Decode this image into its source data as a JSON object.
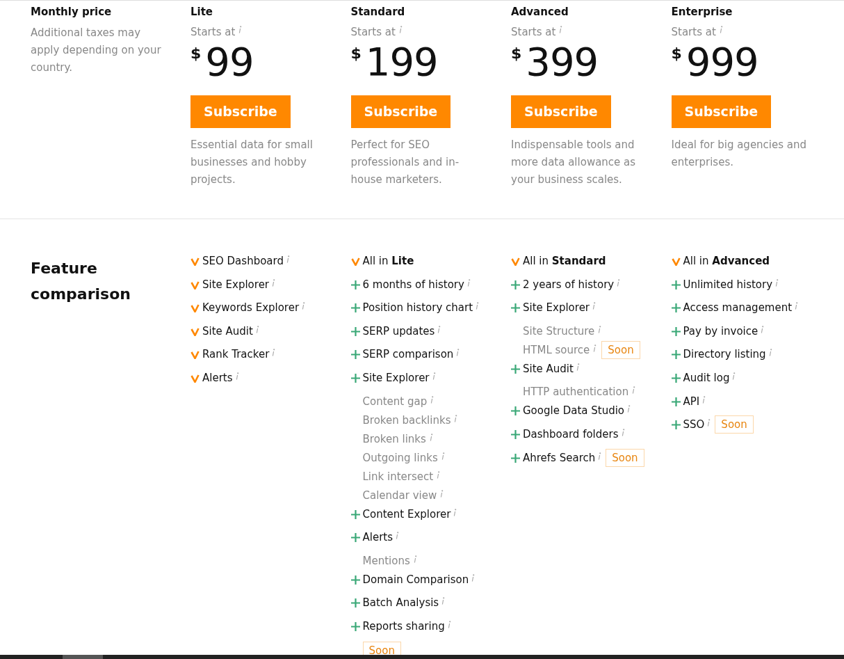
{
  "pricing": {
    "label": "Monthly price",
    "note": "Additional taxes may apply depending on your country."
  },
  "plans": [
    {
      "name": "Lite",
      "starts_at": "Starts at",
      "currency": "$",
      "price": "99",
      "button": "Subscribe",
      "description": "Essential data for small businesses and hobby projects."
    },
    {
      "name": "Standard",
      "starts_at": "Starts at",
      "currency": "$",
      "price": "199",
      "button": "Subscribe",
      "description": "Perfect for SEO professionals and in-house marketers."
    },
    {
      "name": "Advanced",
      "starts_at": "Starts at",
      "currency": "$",
      "price": "399",
      "button": "Subscribe",
      "description": "Indispensable tools and more data allowance as your business scales."
    },
    {
      "name": "Enterprise",
      "starts_at": "Starts at",
      "currency": "$",
      "price": "999",
      "button": "Subscribe",
      "description": "Ideal for big agencies and enterprises."
    }
  ],
  "features": {
    "title": "Feature comparison",
    "columns": [
      [
        {
          "kind": "included",
          "text": "SEO Dashboard",
          "info": true
        },
        {
          "kind": "included",
          "text": "Site Explorer",
          "info": true
        },
        {
          "kind": "included",
          "text": "Keywords Explorer",
          "info": true
        },
        {
          "kind": "included",
          "text": "Site Audit",
          "info": true
        },
        {
          "kind": "included",
          "text": "Rank Tracker",
          "info": true
        },
        {
          "kind": "included",
          "text": "Alerts",
          "info": true
        }
      ],
      [
        {
          "kind": "included",
          "text": "All in **Lite**",
          "info": false
        },
        {
          "kind": "added",
          "text": "6 months of history",
          "info": true
        },
        {
          "kind": "added",
          "text": "Position history chart",
          "info": true
        },
        {
          "kind": "added",
          "text": "SERP updates",
          "info": true
        },
        {
          "kind": "added",
          "text": "SERP comparison",
          "info": true
        },
        {
          "kind": "added",
          "text": "Site Explorer",
          "info": true,
          "children": [
            {
              "text": "Content gap",
              "info": true
            },
            {
              "text": "Broken backlinks",
              "info": true
            },
            {
              "text": "Broken links",
              "info": true
            },
            {
              "text": "Outgoing links",
              "info": true
            },
            {
              "text": "Link intersect",
              "info": true
            },
            {
              "text": "Calendar view",
              "info": true
            }
          ]
        },
        {
          "kind": "added",
          "text": "Content Explorer",
          "info": true
        },
        {
          "kind": "added",
          "text": "Alerts",
          "info": true,
          "children": [
            {
              "text": "Mentions",
              "info": true
            }
          ]
        },
        {
          "kind": "added",
          "text": "Domain Comparison",
          "info": true
        },
        {
          "kind": "added",
          "text": "Batch Analysis",
          "info": true
        },
        {
          "kind": "added",
          "text": "Reports sharing",
          "info": true,
          "badge": "Soon",
          "badge_below": true
        }
      ],
      [
        {
          "kind": "included",
          "text": "All in **Standard**",
          "info": false
        },
        {
          "kind": "added",
          "text": "2 years of history",
          "info": true
        },
        {
          "kind": "added",
          "text": "Site Explorer",
          "info": true,
          "children": [
            {
              "text": "Site Structure",
              "info": true
            },
            {
              "text": "HTML source",
              "info": true,
              "badge": "Soon"
            }
          ]
        },
        {
          "kind": "added",
          "text": "Site Audit",
          "info": true,
          "children": [
            {
              "text": "HTTP authentication",
              "info": true
            }
          ]
        },
        {
          "kind": "added",
          "text": "Google Data Studio",
          "info": true
        },
        {
          "kind": "added",
          "text": "Dashboard folders",
          "info": true
        },
        {
          "kind": "added",
          "text": "Ahrefs Search",
          "info": true,
          "badge": "Soon"
        }
      ],
      [
        {
          "kind": "included",
          "text": "All in **Advanced**",
          "info": false
        },
        {
          "kind": "added",
          "text": "Unlimited history",
          "info": true
        },
        {
          "kind": "added",
          "text": "Access management",
          "info": true
        },
        {
          "kind": "added",
          "text": "Pay by invoice",
          "info": true
        },
        {
          "kind": "added",
          "text": "Directory listing",
          "info": true
        },
        {
          "kind": "added",
          "text": "Audit log",
          "info": true
        },
        {
          "kind": "added",
          "text": "API",
          "info": true
        },
        {
          "kind": "added",
          "text": "SSO",
          "info": true,
          "badge": "Soon"
        }
      ]
    ]
  }
}
